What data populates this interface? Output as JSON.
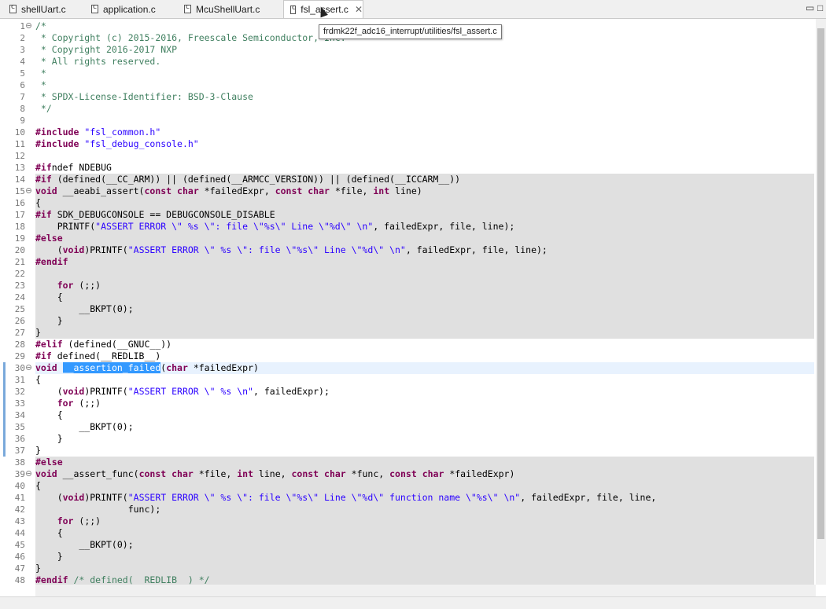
{
  "tabs": [
    {
      "label": "shellUart.c",
      "active": false
    },
    {
      "label": "application.c",
      "active": false
    },
    {
      "label": "McuShellUart.c",
      "active": false
    },
    {
      "label": "fsl_assert.c",
      "active": true
    }
  ],
  "tooltip": "frdmk22f_adc16_interrupt/utilities/fsl_assert.c",
  "editor": {
    "lines": [
      {
        "n": "1",
        "code": "/*"
      },
      {
        "n": "2",
        "code": " * Copyright (c) 2015-2016, Freescale Semiconductor, Inc."
      },
      {
        "n": "3",
        "code": " * Copyright 2016-2017 NXP"
      },
      {
        "n": "4",
        "code": " * All rights reserved."
      },
      {
        "n": "5",
        "code": " *"
      },
      {
        "n": "6",
        "code": " *"
      },
      {
        "n": "7",
        "code": " * SPDX-License-Identifier: BSD-3-Clause"
      },
      {
        "n": "8",
        "code": " */"
      },
      {
        "n": "9",
        "code": ""
      },
      {
        "n": "10",
        "code": "#include \"fsl_common.h\""
      },
      {
        "n": "11",
        "code": "#include \"fsl_debug_console.h\""
      },
      {
        "n": "12",
        "code": ""
      },
      {
        "n": "13",
        "code": "#ifndef NDEBUG"
      },
      {
        "n": "14",
        "code": "#if (defined(__CC_ARM)) || (defined(__ARMCC_VERSION)) || (defined(__ICCARM__))"
      },
      {
        "n": "15",
        "code": "void __aeabi_assert(const char *failedExpr, const char *file, int line)"
      },
      {
        "n": "16",
        "code": "{"
      },
      {
        "n": "17",
        "code": "#if SDK_DEBUGCONSOLE == DEBUGCONSOLE_DISABLE"
      },
      {
        "n": "18",
        "code": "    PRINTF(\"ASSERT ERROR \\\" %s \\\": file \\\"%s\\\" Line \\\"%d\\\" \\n\", failedExpr, file, line);"
      },
      {
        "n": "19",
        "code": "#else"
      },
      {
        "n": "20",
        "code": "    (void)PRINTF(\"ASSERT ERROR \\\" %s \\\": file \\\"%s\\\" Line \\\"%d\\\" \\n\", failedExpr, file, line);"
      },
      {
        "n": "21",
        "code": "#endif"
      },
      {
        "n": "22",
        "code": ""
      },
      {
        "n": "23",
        "code": "    for (;;)"
      },
      {
        "n": "24",
        "code": "    {"
      },
      {
        "n": "25",
        "code": "        __BKPT(0);"
      },
      {
        "n": "26",
        "code": "    }"
      },
      {
        "n": "27",
        "code": "}"
      },
      {
        "n": "28",
        "code": "#elif (defined(__GNUC__))"
      },
      {
        "n": "29",
        "code": "#if defined(__REDLIB__)"
      },
      {
        "n": "30",
        "code": "void __assertion_failed(char *failedExpr)"
      },
      {
        "n": "31",
        "code": "{"
      },
      {
        "n": "32",
        "code": "    (void)PRINTF(\"ASSERT ERROR \\\" %s \\n\", failedExpr);"
      },
      {
        "n": "33",
        "code": "    for (;;)"
      },
      {
        "n": "34",
        "code": "    {"
      },
      {
        "n": "35",
        "code": "        __BKPT(0);"
      },
      {
        "n": "36",
        "code": "    }"
      },
      {
        "n": "37",
        "code": "}"
      },
      {
        "n": "38",
        "code": "#else"
      },
      {
        "n": "39",
        "code": "void __assert_func(const char *file, int line, const char *func, const char *failedExpr)"
      },
      {
        "n": "40",
        "code": "{"
      },
      {
        "n": "41",
        "code": "    (void)PRINTF(\"ASSERT ERROR \\\" %s \\\": file \\\"%s\\\" Line \\\"%d\\\" function name \\\"%s\\\" \\n\", failedExpr, file, line,"
      },
      {
        "n": "42",
        "code": "                 func);"
      },
      {
        "n": "43",
        "code": "    for (;;)"
      },
      {
        "n": "44",
        "code": "    {"
      },
      {
        "n": "45",
        "code": "        __BKPT(0);"
      },
      {
        "n": "46",
        "code": "    }"
      },
      {
        "n": "47",
        "code": "}"
      },
      {
        "n": "48",
        "code": "#endif /* defined(__REDLIB__) */"
      }
    ],
    "shaded_lines": [
      14,
      15,
      16,
      17,
      18,
      19,
      20,
      21,
      22,
      23,
      24,
      25,
      26,
      27,
      38,
      39,
      40,
      41,
      42,
      43,
      44,
      45,
      46,
      47,
      48
    ],
    "current_line": 30,
    "fold_lines": [
      1,
      15,
      30,
      39
    ],
    "selected_text": "__assertion_failed"
  },
  "colors": {
    "keyword": "#7f0055",
    "comment": "#3f7f5f",
    "string": "#2a00ff",
    "inactive_bg": "#e0e0e0",
    "selection": "#3399ff"
  }
}
